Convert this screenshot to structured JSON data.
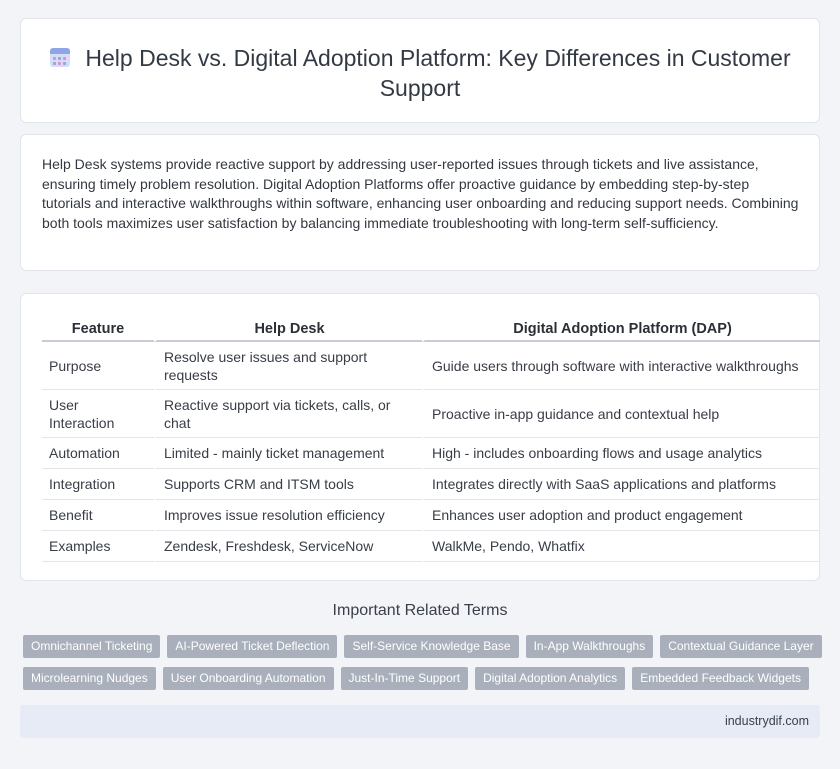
{
  "header": {
    "title": "Help Desk vs. Digital Adoption Platform: Key Differences in Customer Support",
    "icon": "calendar-icon"
  },
  "intro": {
    "text": "Help Desk systems provide reactive support by addressing user-reported issues through tickets and live assistance, ensuring timely problem resolution. Digital Adoption Platforms offer proactive guidance by embedding step-by-step tutorials and interactive walkthroughs within software, enhancing user onboarding and reducing support needs. Combining both tools maximizes user satisfaction by balancing immediate troubleshooting with long-term self-sufficiency."
  },
  "table": {
    "headers": [
      "Feature",
      "Help Desk",
      "Digital Adoption Platform (DAP)"
    ],
    "rows": [
      [
        "Purpose",
        "Resolve user issues and support requests",
        "Guide users through software with interactive walkthroughs"
      ],
      [
        "User Interaction",
        "Reactive support via tickets, calls, or chat",
        "Proactive in-app guidance and contextual help"
      ],
      [
        "Automation",
        "Limited - mainly ticket management",
        "High - includes onboarding flows and usage analytics"
      ],
      [
        "Integration",
        "Supports CRM and ITSM tools",
        "Integrates directly with SaaS applications and platforms"
      ],
      [
        "Benefit",
        "Improves issue resolution efficiency",
        "Enhances user adoption and product engagement"
      ],
      [
        "Examples",
        "Zendesk, Freshdesk, ServiceNow",
        "WalkMe, Pendo, Whatfix"
      ]
    ]
  },
  "terms": {
    "heading": "Important Related Terms",
    "row1": [
      "Omnichannel Ticketing",
      "AI-Powered Ticket Deflection",
      "Self-Service Knowledge Base",
      "In-App Walkthroughs",
      "Contextual Guidance Layer"
    ],
    "row2": [
      "Microlearning Nudges",
      "User Onboarding Automation",
      "Just-In-Time Support",
      "Digital Adoption Analytics",
      "Embedded Feedback Widgets"
    ]
  },
  "footer": {
    "site": "industrydif.com"
  },
  "colors": {
    "background": "#f3f4f8",
    "tag": "#a9b0bb",
    "footer": "#e6ebf6",
    "icon_accent": "#8fa5e6"
  }
}
